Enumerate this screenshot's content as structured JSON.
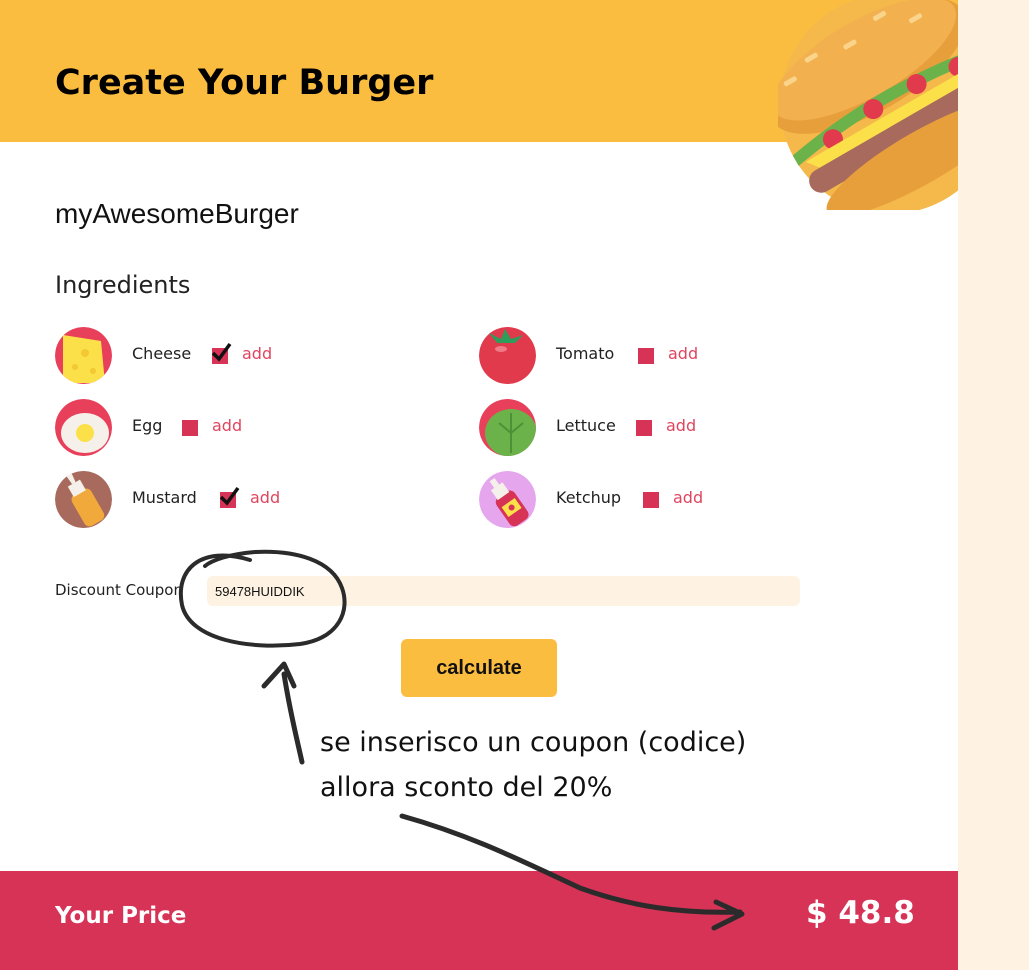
{
  "header": {
    "title": "Create Your Burger"
  },
  "burger_name": "myAwesomeBurger",
  "ingredients_heading": "Ingredients",
  "ingredients": [
    {
      "name": "Cheese",
      "checked": true,
      "add_label": "add",
      "icon": "cheese-icon"
    },
    {
      "name": "Tomato",
      "checked": false,
      "add_label": "add",
      "icon": "tomato-icon"
    },
    {
      "name": "Egg",
      "checked": false,
      "add_label": "add",
      "icon": "egg-icon"
    },
    {
      "name": "Lettuce",
      "checked": false,
      "add_label": "add",
      "icon": "lettuce-icon"
    },
    {
      "name": "Mustard",
      "checked": true,
      "add_label": "add",
      "icon": "mustard-icon"
    },
    {
      "name": "Ketchup",
      "checked": false,
      "add_label": "add",
      "icon": "ketchup-icon"
    }
  ],
  "coupon": {
    "label": "Discount Coupon",
    "value": "59478HUIDDIK"
  },
  "calculate_label": "calculate",
  "annotation": {
    "line1": "se inserisco un coupon (codice)",
    "line2": "allora sconto del 20%"
  },
  "footer": {
    "price_label": "Your Price",
    "price_value": "$ 48.8"
  },
  "colors": {
    "accent_yellow": "#fbbd3f",
    "accent_red": "#d63357",
    "add_link": "#e0455f",
    "side_background": "#fef3e2"
  }
}
